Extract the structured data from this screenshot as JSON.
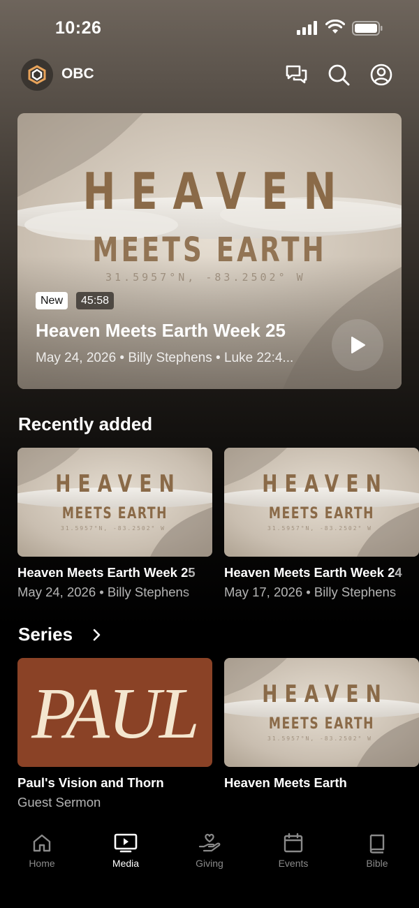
{
  "status_bar": {
    "time": "10:26"
  },
  "header": {
    "church_name": "OBC"
  },
  "featured": {
    "art_title_line1": "HEAVEN",
    "art_title_line2": "MEETS EARTH",
    "art_coords": "31.5957°N, -83.2502° W",
    "badge_new": "New",
    "duration": "45:58",
    "title": "Heaven Meets Earth Week 25",
    "meta": "May 24, 2026 • Billy Stephens • Luke 22:4..."
  },
  "recently_added": {
    "heading": "Recently added",
    "items": [
      {
        "title": "Heaven Meets Earth Week 25",
        "subtitle": "May 24, 2026 • Billy Stephens"
      },
      {
        "title": "Heaven Meets Earth Week 24",
        "subtitle": "May 17, 2026 • Billy Stephens"
      }
    ]
  },
  "series": {
    "heading": "Series",
    "items": [
      {
        "title": "Paul's Vision and Thorn",
        "subtitle": "Guest Sermon",
        "art_text": "PAUL"
      },
      {
        "title": "Heaven Meets Earth",
        "subtitle": ""
      }
    ]
  },
  "tab_bar": {
    "items": [
      {
        "label": "Home",
        "icon": "home-icon"
      },
      {
        "label": "Media",
        "icon": "media-icon"
      },
      {
        "label": "Giving",
        "icon": "giving-icon"
      },
      {
        "label": "Events",
        "icon": "events-icon"
      },
      {
        "label": "Bible",
        "icon": "bible-icon"
      }
    ],
    "active": "Media"
  },
  "colors": {
    "art_text_brown": "#8a6a48",
    "art_bg": "#cfc6bb",
    "paul_bg": "#8a4226",
    "paul_text": "#f4e6cf"
  }
}
